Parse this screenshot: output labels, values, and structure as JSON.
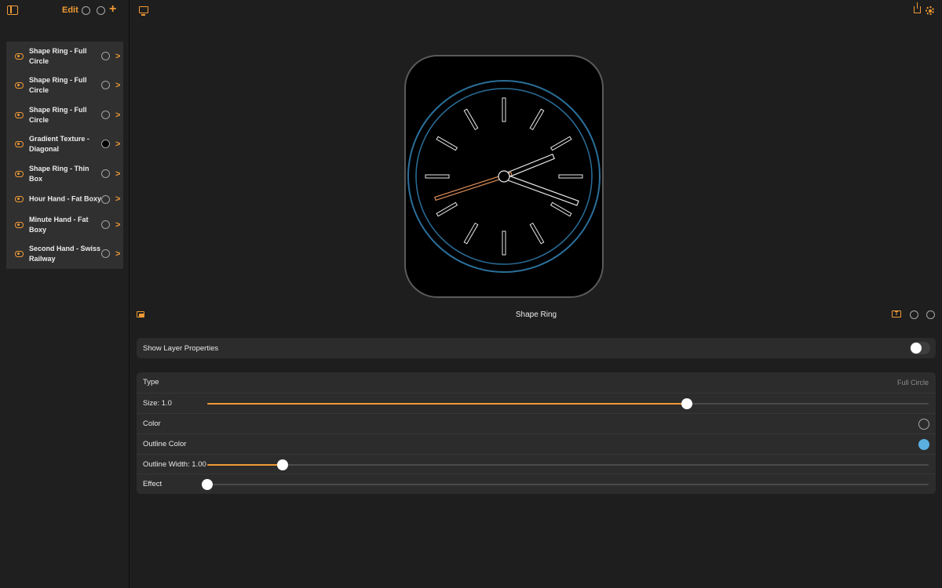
{
  "sidebar": {
    "edit_label": "Edit",
    "layers": [
      {
        "label": "Shape Ring - Full Circle",
        "swatch": "empty"
      },
      {
        "label": "Shape Ring - Full Circle",
        "swatch": "empty"
      },
      {
        "label": "Shape Ring - Full Circle",
        "swatch": "empty"
      },
      {
        "label": "Gradient Texture - Diagonal",
        "swatch": "black"
      },
      {
        "label": "Shape Ring - Thin Box",
        "swatch": "empty"
      },
      {
        "label": "Hour Hand - Fat Boxy",
        "swatch": "empty"
      },
      {
        "label": "Minute Hand - Fat Boxy",
        "swatch": "empty"
      },
      {
        "label": "Second Hand - Swiss Railway",
        "swatch": "empty"
      }
    ]
  },
  "editor": {
    "layer_title": "Shape Ring",
    "show_layer_properties_label": "Show Layer Properties",
    "show_layer_properties_on": false,
    "type_label": "Type",
    "type_value": "Full Circle",
    "size_label": "Size: 1.0",
    "size_fraction": 0.665,
    "color_label": "Color",
    "outline_color_label": "Outline Color",
    "outline_color": "#5ab0e0",
    "outline_width_label": "Outline Width: 1.00",
    "outline_width_fraction": 0.105,
    "effect_label": "Effect",
    "effect_fraction": 0.0
  },
  "colors": {
    "accent": "#f09a36",
    "ring": "#2a6f9a",
    "second_hand": "#e0905a"
  }
}
